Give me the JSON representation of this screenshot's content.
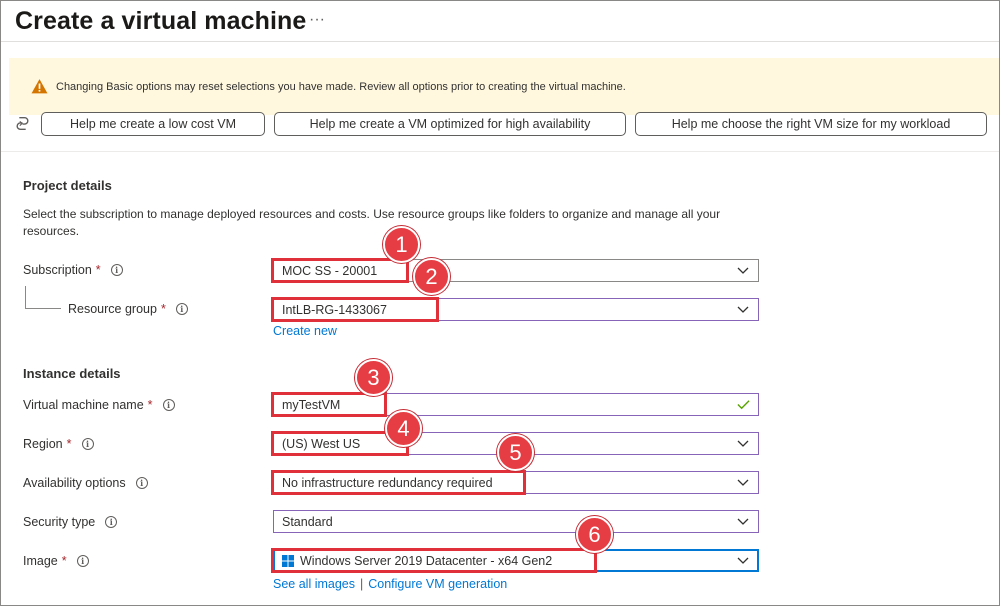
{
  "header": {
    "title": "Create a virtual machine",
    "more": "···"
  },
  "warning": {
    "text": "Changing Basic options may reset selections you have made. Review all options prior to creating the virtual machine."
  },
  "help_buttons": [
    {
      "label": "Help me create a low cost VM"
    },
    {
      "label": "Help me create a VM optimized for high availability"
    },
    {
      "label": "Help me choose the right VM size for my workload"
    }
  ],
  "project": {
    "heading": "Project details",
    "description": "Select the subscription to manage deployed resources and costs. Use resource groups like folders to organize and manage all your resources.",
    "subscription": {
      "label": "Subscription",
      "value": "MOC SS - 20001"
    },
    "resource_group": {
      "label": "Resource group",
      "value": "IntLB-RG-1433067",
      "create_new": "Create new"
    }
  },
  "instance": {
    "heading": "Instance details",
    "vm_name": {
      "label": "Virtual machine name",
      "value": "myTestVM"
    },
    "region": {
      "label": "Region",
      "value": "(US) West US"
    },
    "availability": {
      "label": "Availability options",
      "value": "No infrastructure redundancy required"
    },
    "security": {
      "label": "Security type",
      "value": "Standard"
    },
    "image": {
      "label": "Image",
      "value": "Windows Server 2019 Datacenter - x64 Gen2",
      "see_all": "See all images",
      "separator": "|",
      "configure": "Configure VM generation"
    }
  },
  "common": {
    "required": "*",
    "info": "i"
  },
  "callouts": [
    "1",
    "2",
    "3",
    "4",
    "5",
    "6"
  ],
  "colors": {
    "accent": "#0078d4",
    "highlight": "#e0303a",
    "badge": "#e63d45",
    "warning_bg": "#fff8df",
    "valid_check": "#57a300"
  },
  "icons": {
    "warning": "warning-triangle-icon",
    "copilot": "copilot-icon",
    "dropdown": "chevron-down-icon",
    "valid": "checkmark-icon",
    "image": "windows-logo-icon"
  }
}
